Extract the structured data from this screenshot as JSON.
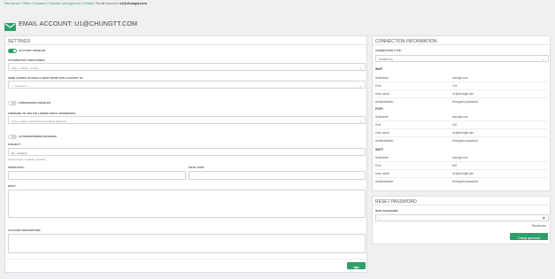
{
  "breadcrumb": {
    "items": [
      "This server",
      "Web",
      "Domains",
      "Domain: chungtt.com",
      "Emails"
    ],
    "separator": "/",
    "current_prefix": "Email Account:",
    "current": "u1@chungtt.com"
  },
  "page_title": "EMAIL ACCOUNT: U1@CHUNGTT.COM",
  "settings": {
    "header": "SETTINGS",
    "account_enabled_label": "ACCOUNT ENABLED",
    "account_enabled": true,
    "alt_names_label": "ALTERNATIVE USER NAMES:",
    "alt_names_placeholder": "Alias, mailbox, sender...",
    "send_copies_label": "SEND COPIES OF EMAILS SENT FROM THIS ACCOUNT TO:",
    "send_copies_value": "— Nowhere —",
    "forwarding_label": "FORWARDING ENABLED",
    "forwarding_enabled": false,
    "forward_to_label": "FORWARD TO THE FOLLOWING EMAIL ADDRESSES:",
    "forward_to_placeholder": "Type a valid email address (multiple allowed)",
    "autoresponder_label": "AUTORESPONDER ENABLED",
    "autoresponder_enabled": false,
    "subject_label": "SUBJECT:",
    "subject_value": "Re: (subject)",
    "subject_hint": "Allowed tags: (subject), (sender)",
    "from_date_label": "FROM DATE:",
    "until_date_label": "UNTIL DATE:",
    "body_label": "BODY:",
    "description_label": "ACCOUNT DESCRIPTION:",
    "save_label": "Save"
  },
  "connection": {
    "header": "CONNECTION INFORMATION",
    "type_label": "CONNECTION TYPE:",
    "type_value": "STARTTLS",
    "sections": [
      {
        "name": "IMAP",
        "rows": [
          {
            "key": "Hostname:",
            "value": "chungtt.com"
          },
          {
            "key": "Port:",
            "value": "143"
          },
          {
            "key": "User name:",
            "value": "u1@chungtt.com"
          },
          {
            "key": "Authentication:",
            "value": "Encrypted password"
          }
        ]
      },
      {
        "name": "POP3",
        "rows": [
          {
            "key": "Hostname:",
            "value": "chungtt.com"
          },
          {
            "key": "Port:",
            "value": "110"
          },
          {
            "key": "User name:",
            "value": "u1@chungtt.com"
          },
          {
            "key": "Authentication:",
            "value": "Encrypted password"
          }
        ]
      },
      {
        "name": "SMTP",
        "rows": [
          {
            "key": "Hostname:",
            "value": "chungtt.com"
          },
          {
            "key": "Port:",
            "value": "587"
          },
          {
            "key": "User name:",
            "value": "u1@chungtt.com"
          },
          {
            "key": "Authentication:",
            "value": "Encrypted password"
          }
        ]
      }
    ]
  },
  "reset_password": {
    "header": "RESET PASSWORD",
    "new_password_label": "NEW PASSWORD:",
    "new_password_value": "•",
    "randomize_label": "Randomize",
    "change_label": "Change password"
  },
  "colors": {
    "accent": "#2f9e6a",
    "page_bg": "#eef0f2",
    "panel_bg": "#ffffff"
  },
  "icons": {
    "title": "envelope-icon",
    "save": "save-icon",
    "change": "key-icon",
    "visibility": "eye-icon"
  }
}
